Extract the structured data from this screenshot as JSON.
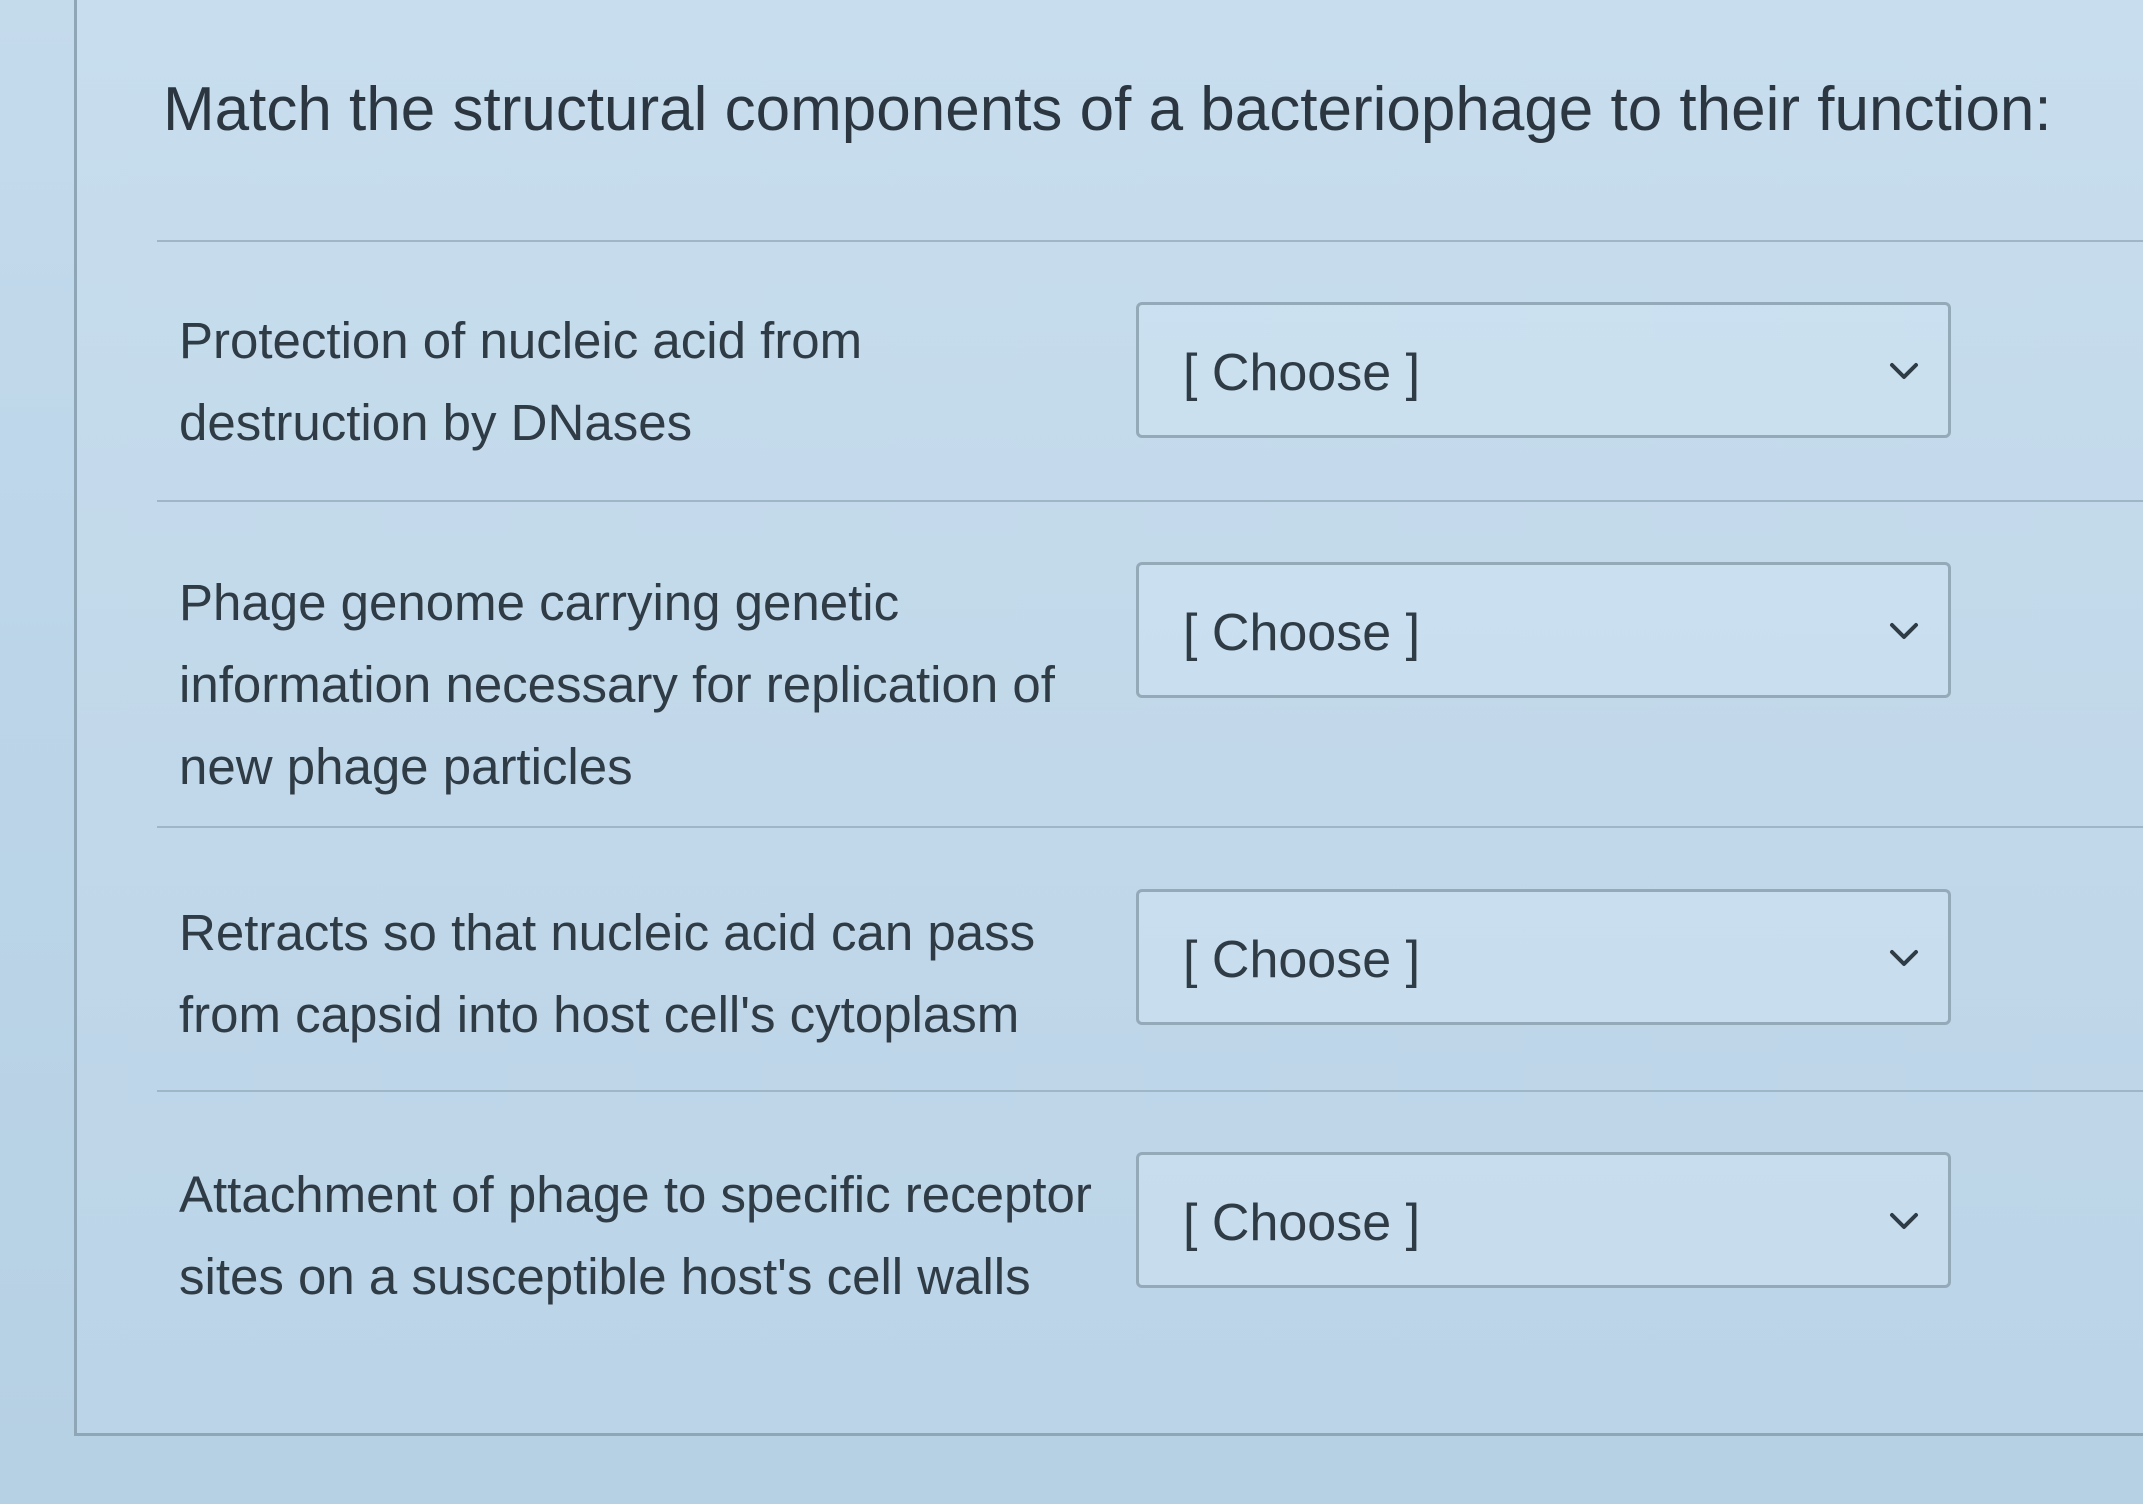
{
  "question": {
    "title": "Match the structural components of a bacteriophage to their function:"
  },
  "rows": [
    {
      "prompt": "Protection of nucleic acid from\ndestruction by DNases",
      "selected": "[ Choose ]"
    },
    {
      "prompt": "Phage genome carrying genetic\ninformation necessary for replication of\nnew phage particles",
      "selected": "[ Choose ]"
    },
    {
      "prompt": "Retracts so that nucleic acid can pass\nfrom capsid into host cell's cytoplasm",
      "selected": "[ Choose ]"
    },
    {
      "prompt": "Attachment of phage to specific receptor\nsites on a susceptible host's cell walls",
      "selected": "[ Choose ]"
    }
  ],
  "icons": {
    "dropdown": "chevron-down-icon"
  },
  "colors": {
    "background": "#c1d8ea",
    "border": "#95aab9",
    "text": "#2f3b45"
  }
}
